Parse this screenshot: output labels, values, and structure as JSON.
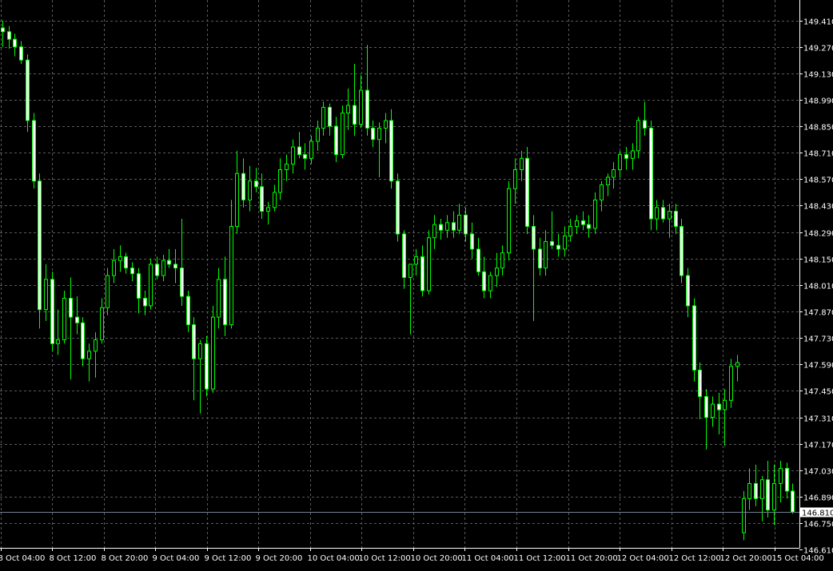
{
  "chart_data": {
    "type": "candlestick",
    "y_range": [
      146.61,
      149.48
    ],
    "y_ticks": [
      "149.410",
      "149.270",
      "149.130",
      "148.990",
      "148.850",
      "148.710",
      "148.570",
      "148.430",
      "148.290",
      "148.150",
      "148.010",
      "147.870",
      "147.730",
      "147.590",
      "147.450",
      "147.310",
      "147.170",
      "147.030",
      "146.890",
      "146.750",
      "146.610"
    ],
    "x_ticks": [
      "8 Oct 04:00",
      "8 Oct 12:00",
      "8 Oct 20:00",
      "9 Oct 04:00",
      "9 Oct 12:00",
      "9 Oct 20:00",
      "10 Oct 04:00",
      "10 Oct 12:00",
      "10 Oct 20:00",
      "11 Oct 04:00",
      "11 Oct 12:00",
      "11 Oct 20:00",
      "12 Oct 04:00",
      "12 Oct 12:00",
      "12 Oct 20:00",
      "15 Oct 04:00"
    ],
    "current_price": "146.810",
    "grid": true,
    "colors": {
      "background": "#000000",
      "grid": "#5a5a5a",
      "candle": "#00ff00",
      "bull_body": "#000000",
      "bear_body": "#ffffff",
      "axis_text": "#ffffff",
      "price_line": "#708090",
      "price_label_bg": "#ffffff",
      "price_label_text": "#000000"
    },
    "candles": [
      {
        "o": 149.37,
        "h": 149.41,
        "l": 149.27,
        "c": 149.35
      },
      {
        "o": 149.35,
        "h": 149.38,
        "l": 149.26,
        "c": 149.31
      },
      {
        "o": 149.31,
        "h": 149.34,
        "l": 149.22,
        "c": 149.27
      },
      {
        "o": 149.27,
        "h": 149.3,
        "l": 149.18,
        "c": 149.2
      },
      {
        "o": 149.2,
        "h": 149.23,
        "l": 148.82,
        "c": 148.88
      },
      {
        "o": 148.88,
        "h": 148.92,
        "l": 148.52,
        "c": 148.56
      },
      {
        "o": 148.56,
        "h": 148.6,
        "l": 147.78,
        "c": 147.88
      },
      {
        "o": 147.88,
        "h": 148.12,
        "l": 147.82,
        "c": 148.04
      },
      {
        "o": 148.04,
        "h": 148.08,
        "l": 147.66,
        "c": 147.7
      },
      {
        "o": 147.7,
        "h": 147.88,
        "l": 147.64,
        "c": 147.72
      },
      {
        "o": 147.72,
        "h": 147.98,
        "l": 147.7,
        "c": 147.94
      },
      {
        "o": 147.94,
        "h": 148.05,
        "l": 147.51,
        "c": 147.84
      },
      {
        "o": 147.84,
        "h": 147.95,
        "l": 147.75,
        "c": 147.81
      },
      {
        "o": 147.81,
        "h": 147.84,
        "l": 147.58,
        "c": 147.62
      },
      {
        "o": 147.62,
        "h": 147.7,
        "l": 147.5,
        "c": 147.66
      },
      {
        "o": 147.66,
        "h": 147.76,
        "l": 147.52,
        "c": 147.72
      },
      {
        "o": 147.72,
        "h": 147.94,
        "l": 147.7,
        "c": 147.89
      },
      {
        "o": 147.89,
        "h": 148.1,
        "l": 147.85,
        "c": 148.06
      },
      {
        "o": 148.06,
        "h": 148.2,
        "l": 148.02,
        "c": 148.14
      },
      {
        "o": 148.14,
        "h": 148.22,
        "l": 148.08,
        "c": 148.16
      },
      {
        "o": 148.16,
        "h": 148.18,
        "l": 148.07,
        "c": 148.1
      },
      {
        "o": 148.1,
        "h": 148.13,
        "l": 148.03,
        "c": 148.07
      },
      {
        "o": 148.07,
        "h": 148.1,
        "l": 147.86,
        "c": 147.94
      },
      {
        "o": 147.94,
        "h": 147.98,
        "l": 147.85,
        "c": 147.9
      },
      {
        "o": 147.9,
        "h": 148.15,
        "l": 147.88,
        "c": 148.12
      },
      {
        "o": 148.12,
        "h": 148.16,
        "l": 148.04,
        "c": 148.06
      },
      {
        "o": 148.06,
        "h": 148.17,
        "l": 148.03,
        "c": 148.14
      },
      {
        "o": 148.14,
        "h": 148.2,
        "l": 148.1,
        "c": 148.12
      },
      {
        "o": 148.12,
        "h": 148.2,
        "l": 148.02,
        "c": 148.1
      },
      {
        "o": 148.1,
        "h": 148.36,
        "l": 147.9,
        "c": 147.95
      },
      {
        "o": 147.95,
        "h": 147.98,
        "l": 147.76,
        "c": 147.8
      },
      {
        "o": 147.8,
        "h": 147.84,
        "l": 147.4,
        "c": 147.62
      },
      {
        "o": 147.62,
        "h": 147.72,
        "l": 147.33,
        "c": 147.7
      },
      {
        "o": 147.7,
        "h": 147.74,
        "l": 147.42,
        "c": 147.46
      },
      {
        "o": 147.46,
        "h": 147.9,
        "l": 147.44,
        "c": 147.84
      },
      {
        "o": 147.84,
        "h": 148.1,
        "l": 147.78,
        "c": 148.04
      },
      {
        "o": 148.04,
        "h": 148.16,
        "l": 147.74,
        "c": 147.8
      },
      {
        "o": 147.8,
        "h": 148.46,
        "l": 147.78,
        "c": 148.32
      },
      {
        "o": 148.32,
        "h": 148.72,
        "l": 148.28,
        "c": 148.6
      },
      {
        "o": 148.6,
        "h": 148.68,
        "l": 148.42,
        "c": 148.46
      },
      {
        "o": 148.46,
        "h": 148.64,
        "l": 148.4,
        "c": 148.56
      },
      {
        "o": 148.56,
        "h": 148.63,
        "l": 148.5,
        "c": 148.53
      },
      {
        "o": 148.53,
        "h": 148.6,
        "l": 148.36,
        "c": 148.4
      },
      {
        "o": 148.4,
        "h": 148.45,
        "l": 148.33,
        "c": 148.42
      },
      {
        "o": 148.42,
        "h": 148.54,
        "l": 148.4,
        "c": 148.5
      },
      {
        "o": 148.5,
        "h": 148.68,
        "l": 148.46,
        "c": 148.62
      },
      {
        "o": 148.62,
        "h": 148.7,
        "l": 148.56,
        "c": 148.65
      },
      {
        "o": 148.65,
        "h": 148.78,
        "l": 148.6,
        "c": 148.74
      },
      {
        "o": 148.74,
        "h": 148.82,
        "l": 148.68,
        "c": 148.7
      },
      {
        "o": 148.7,
        "h": 148.76,
        "l": 148.62,
        "c": 148.68
      },
      {
        "o": 148.68,
        "h": 148.8,
        "l": 148.65,
        "c": 148.77
      },
      {
        "o": 148.77,
        "h": 148.88,
        "l": 148.72,
        "c": 148.84
      },
      {
        "o": 148.84,
        "h": 148.98,
        "l": 148.8,
        "c": 148.95
      },
      {
        "o": 148.95,
        "h": 148.97,
        "l": 148.8,
        "c": 148.85
      },
      {
        "o": 148.85,
        "h": 148.9,
        "l": 148.66,
        "c": 148.7
      },
      {
        "o": 148.7,
        "h": 148.96,
        "l": 148.68,
        "c": 148.92
      },
      {
        "o": 148.92,
        "h": 149.05,
        "l": 148.83,
        "c": 148.96
      },
      {
        "o": 148.96,
        "h": 149.18,
        "l": 148.8,
        "c": 148.86
      },
      {
        "o": 148.86,
        "h": 149.12,
        "l": 148.84,
        "c": 149.04
      },
      {
        "o": 149.04,
        "h": 149.28,
        "l": 148.8,
        "c": 148.84
      },
      {
        "o": 148.84,
        "h": 148.88,
        "l": 148.74,
        "c": 148.78
      },
      {
        "o": 148.78,
        "h": 148.87,
        "l": 148.58,
        "c": 148.84
      },
      {
        "o": 148.84,
        "h": 148.92,
        "l": 148.76,
        "c": 148.88
      },
      {
        "o": 148.88,
        "h": 148.94,
        "l": 148.52,
        "c": 148.56
      },
      {
        "o": 148.56,
        "h": 148.6,
        "l": 148.24,
        "c": 148.28
      },
      {
        "o": 148.28,
        "h": 148.3,
        "l": 147.99,
        "c": 148.05
      },
      {
        "o": 148.05,
        "h": 148.1,
        "l": 147.75,
        "c": 148.12
      },
      {
        "o": 148.12,
        "h": 148.2,
        "l": 148.06,
        "c": 148.16
      },
      {
        "o": 148.16,
        "h": 148.22,
        "l": 147.95,
        "c": 147.98
      },
      {
        "o": 147.98,
        "h": 148.3,
        "l": 147.96,
        "c": 148.26
      },
      {
        "o": 148.26,
        "h": 148.38,
        "l": 148.2,
        "c": 148.33
      },
      {
        "o": 148.33,
        "h": 148.36,
        "l": 148.25,
        "c": 148.3
      },
      {
        "o": 148.3,
        "h": 148.38,
        "l": 148.26,
        "c": 148.34
      },
      {
        "o": 148.34,
        "h": 148.4,
        "l": 148.26,
        "c": 148.3
      },
      {
        "o": 148.3,
        "h": 148.44,
        "l": 148.28,
        "c": 148.38
      },
      {
        "o": 148.38,
        "h": 148.42,
        "l": 148.24,
        "c": 148.28
      },
      {
        "o": 148.28,
        "h": 148.34,
        "l": 148.15,
        "c": 148.2
      },
      {
        "o": 148.2,
        "h": 148.26,
        "l": 148.06,
        "c": 148.08
      },
      {
        "o": 148.08,
        "h": 148.16,
        "l": 147.94,
        "c": 147.98
      },
      {
        "o": 147.98,
        "h": 148.08,
        "l": 147.94,
        "c": 148.06
      },
      {
        "o": 148.06,
        "h": 148.18,
        "l": 148.0,
        "c": 148.1
      },
      {
        "o": 148.1,
        "h": 148.22,
        "l": 148.06,
        "c": 148.18
      },
      {
        "o": 148.18,
        "h": 148.56,
        "l": 148.14,
        "c": 148.52
      },
      {
        "o": 148.52,
        "h": 148.68,
        "l": 148.44,
        "c": 148.62
      },
      {
        "o": 148.62,
        "h": 148.72,
        "l": 148.56,
        "c": 148.68
      },
      {
        "o": 148.68,
        "h": 148.74,
        "l": 148.28,
        "c": 148.32
      },
      {
        "o": 148.32,
        "h": 148.38,
        "l": 147.82,
        "c": 148.2
      },
      {
        "o": 148.2,
        "h": 148.26,
        "l": 148.06,
        "c": 148.1
      },
      {
        "o": 148.1,
        "h": 148.3,
        "l": 148.06,
        "c": 148.24
      },
      {
        "o": 148.24,
        "h": 148.4,
        "l": 148.2,
        "c": 148.22
      },
      {
        "o": 148.22,
        "h": 148.28,
        "l": 148.16,
        "c": 148.2
      },
      {
        "o": 148.2,
        "h": 148.32,
        "l": 148.16,
        "c": 148.27
      },
      {
        "o": 148.27,
        "h": 148.36,
        "l": 148.24,
        "c": 148.32
      },
      {
        "o": 148.32,
        "h": 148.38,
        "l": 148.28,
        "c": 148.35
      },
      {
        "o": 148.35,
        "h": 148.4,
        "l": 148.3,
        "c": 148.33
      },
      {
        "o": 148.33,
        "h": 148.38,
        "l": 148.26,
        "c": 148.31
      },
      {
        "o": 148.31,
        "h": 148.5,
        "l": 148.28,
        "c": 148.46
      },
      {
        "o": 148.46,
        "h": 148.56,
        "l": 148.4,
        "c": 148.54
      },
      {
        "o": 148.54,
        "h": 148.6,
        "l": 148.48,
        "c": 148.58
      },
      {
        "o": 148.58,
        "h": 148.66,
        "l": 148.52,
        "c": 148.62
      },
      {
        "o": 148.62,
        "h": 148.72,
        "l": 148.58,
        "c": 148.7
      },
      {
        "o": 148.7,
        "h": 148.74,
        "l": 148.62,
        "c": 148.68
      },
      {
        "o": 148.68,
        "h": 148.76,
        "l": 148.62,
        "c": 148.72
      },
      {
        "o": 148.72,
        "h": 148.9,
        "l": 148.68,
        "c": 148.88
      },
      {
        "o": 148.88,
        "h": 148.98,
        "l": 148.8,
        "c": 148.84
      },
      {
        "o": 148.84,
        "h": 148.88,
        "l": 148.3,
        "c": 148.36
      },
      {
        "o": 148.36,
        "h": 148.46,
        "l": 148.3,
        "c": 148.42
      },
      {
        "o": 148.42,
        "h": 148.46,
        "l": 148.34,
        "c": 148.36
      },
      {
        "o": 148.36,
        "h": 148.44,
        "l": 148.26,
        "c": 148.4
      },
      {
        "o": 148.4,
        "h": 148.44,
        "l": 148.28,
        "c": 148.32
      },
      {
        "o": 148.32,
        "h": 148.36,
        "l": 148.02,
        "c": 148.06
      },
      {
        "o": 148.06,
        "h": 148.1,
        "l": 147.84,
        "c": 147.9
      },
      {
        "o": 147.9,
        "h": 147.94,
        "l": 147.5,
        "c": 147.56
      },
      {
        "o": 147.56,
        "h": 147.6,
        "l": 147.3,
        "c": 147.42
      },
      {
        "o": 147.42,
        "h": 147.46,
        "l": 147.14,
        "c": 147.31
      },
      {
        "o": 147.31,
        "h": 147.42,
        "l": 147.26,
        "c": 147.38
      },
      {
        "o": 147.38,
        "h": 147.44,
        "l": 147.22,
        "c": 147.35
      },
      {
        "o": 147.35,
        "h": 147.46,
        "l": 147.16,
        "c": 147.4
      },
      {
        "o": 147.4,
        "h": 147.62,
        "l": 147.36,
        "c": 147.58
      },
      {
        "o": 147.58,
        "h": 147.64,
        "l": 147.5,
        "c": 147.6
      },
      {
        "o": 146.7,
        "h": 146.92,
        "l": 146.66,
        "c": 146.88
      },
      {
        "o": 146.88,
        "h": 147.04,
        "l": 146.82,
        "c": 146.96
      },
      {
        "o": 146.96,
        "h": 147.06,
        "l": 146.84,
        "c": 146.88
      },
      {
        "o": 146.88,
        "h": 147.0,
        "l": 146.76,
        "c": 146.98
      },
      {
        "o": 146.98,
        "h": 147.08,
        "l": 146.78,
        "c": 146.82
      },
      {
        "o": 146.82,
        "h": 147.06,
        "l": 146.74,
        "c": 146.96
      },
      {
        "o": 146.96,
        "h": 147.08,
        "l": 146.86,
        "c": 147.04
      },
      {
        "o": 147.04,
        "h": 147.07,
        "l": 146.88,
        "c": 146.92
      },
      {
        "o": 146.92,
        "h": 146.96,
        "l": 146.8,
        "c": 146.81
      }
    ]
  }
}
